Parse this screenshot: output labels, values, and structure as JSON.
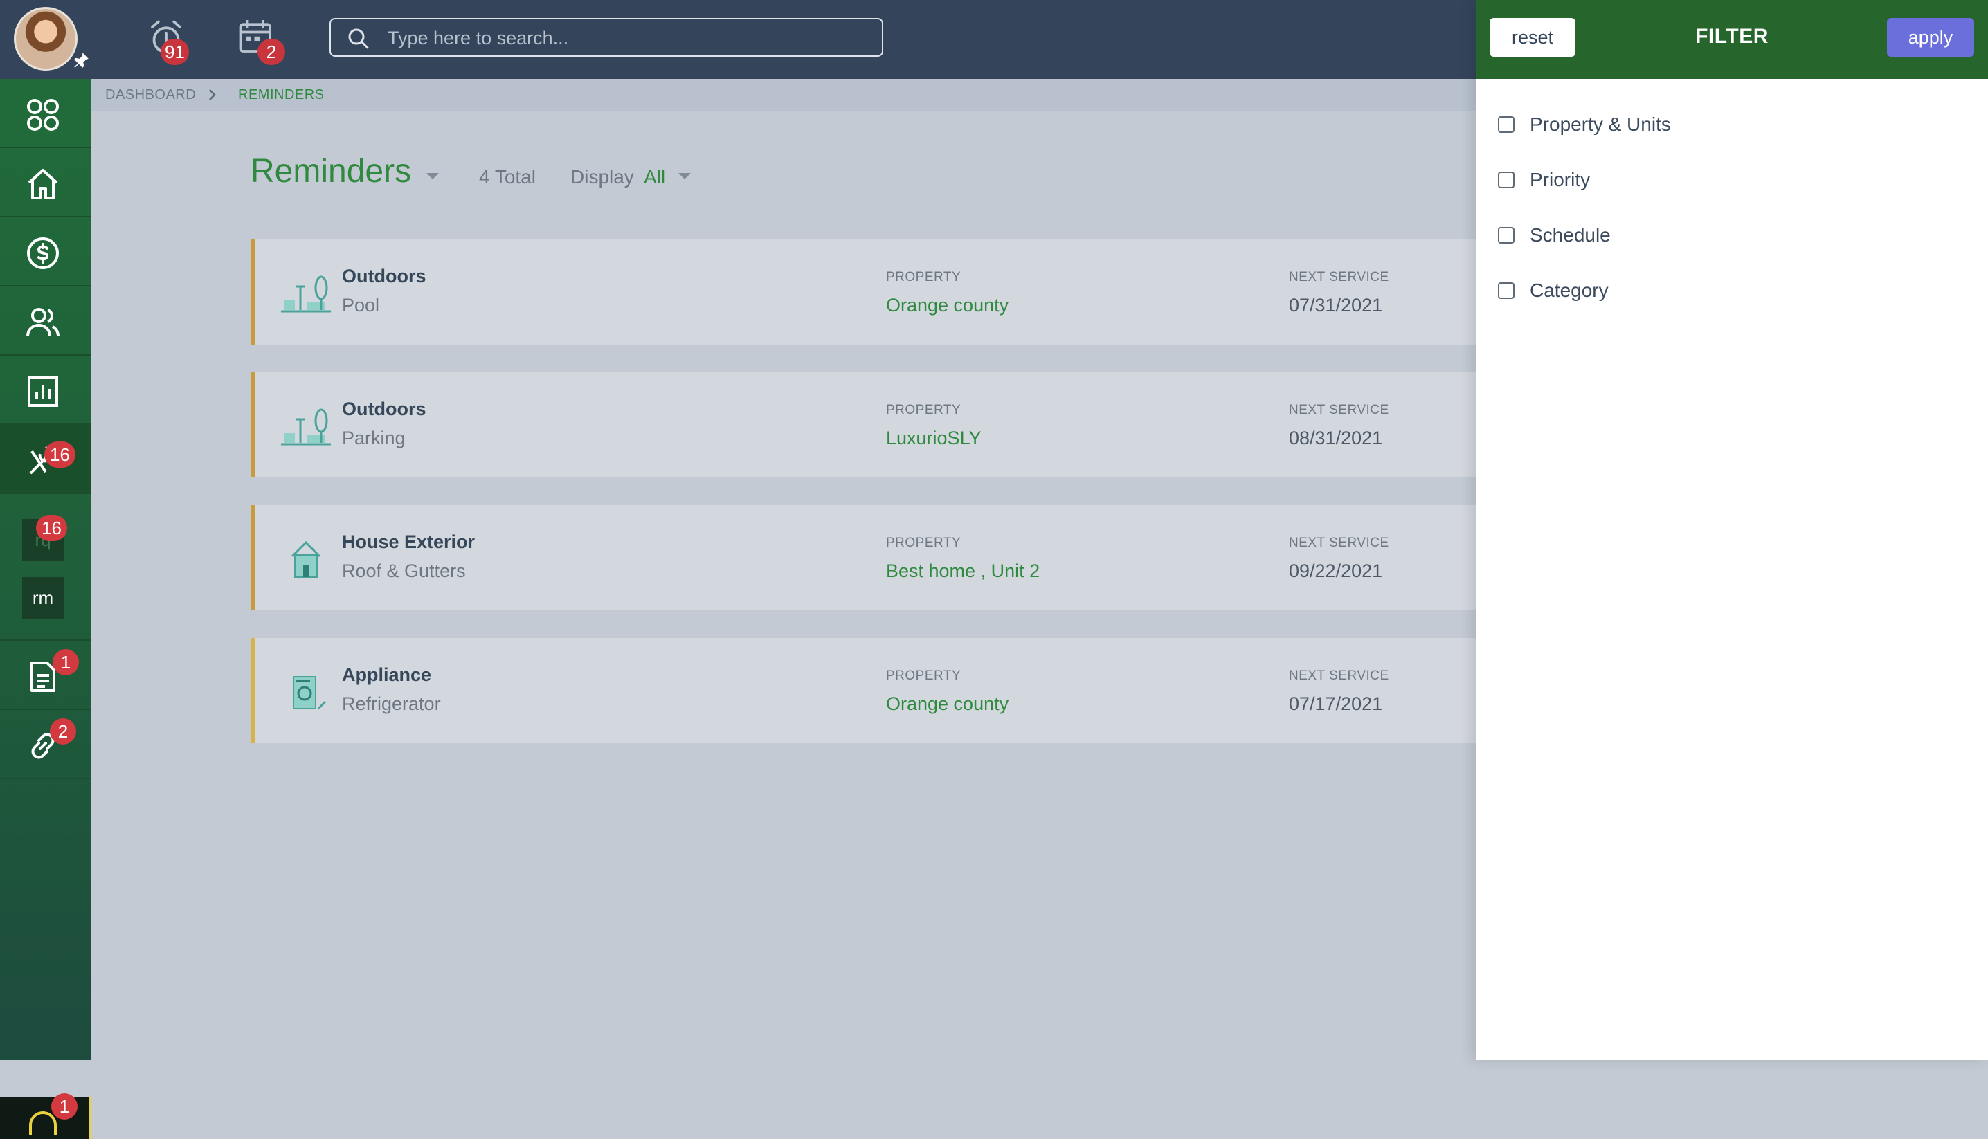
{
  "topbar": {
    "reminders_badge": "91",
    "calendar_badge": "2",
    "search_placeholder": "Type here to search..."
  },
  "sidebar": {
    "maintenance_badge": "16",
    "rq_label": "rq",
    "rq_badge": "16",
    "rm_label": "rm",
    "documents_badge": "1",
    "links_badge": "2",
    "support_badge": "1"
  },
  "breadcrumb": {
    "dashboard": "DASHBOARD",
    "current": "REMINDERS"
  },
  "page": {
    "title": "Reminders",
    "total": "4 Total",
    "display_label": "Display",
    "display_value": "All"
  },
  "reminders": [
    {
      "category": "Outdoors",
      "item": "Pool",
      "property_label": "PROPERTY",
      "property": "Orange county",
      "next_label": "NEXT SERVICE",
      "next_service": "07/31/2021",
      "icon": "park-icon"
    },
    {
      "category": "Outdoors",
      "item": "Parking",
      "property_label": "PROPERTY",
      "property": "LuxurioSLY",
      "next_label": "NEXT SERVICE",
      "next_service": "08/31/2021",
      "icon": "park-icon"
    },
    {
      "category": "House Exterior",
      "item": "Roof & Gutters",
      "property_label": "PROPERTY",
      "property": "Best home , Unit 2",
      "next_label": "NEXT SERVICE",
      "next_service": "09/22/2021",
      "icon": "house-icon"
    },
    {
      "category": "Appliance",
      "item": "Refrigerator",
      "property_label": "PROPERTY",
      "property": "Orange county",
      "next_label": "NEXT SERVICE",
      "next_service": "07/17/2021",
      "icon": "appliance-icon"
    }
  ],
  "filter": {
    "reset_label": "reset",
    "title": "FILTER",
    "apply_label": "apply",
    "options": [
      "Property & Units",
      "Priority",
      "Schedule",
      "Category"
    ]
  },
  "colors": {
    "topbar": "#34455b",
    "sidebar_green": "#216b3a",
    "accent_green": "#2f8a3f",
    "filter_header": "#26662d",
    "apply_purple": "#6b6fdc",
    "badge_red": "#c9353c",
    "card_border_orange": "#c99b3c",
    "card_border_yellow": "#d8b34a"
  }
}
